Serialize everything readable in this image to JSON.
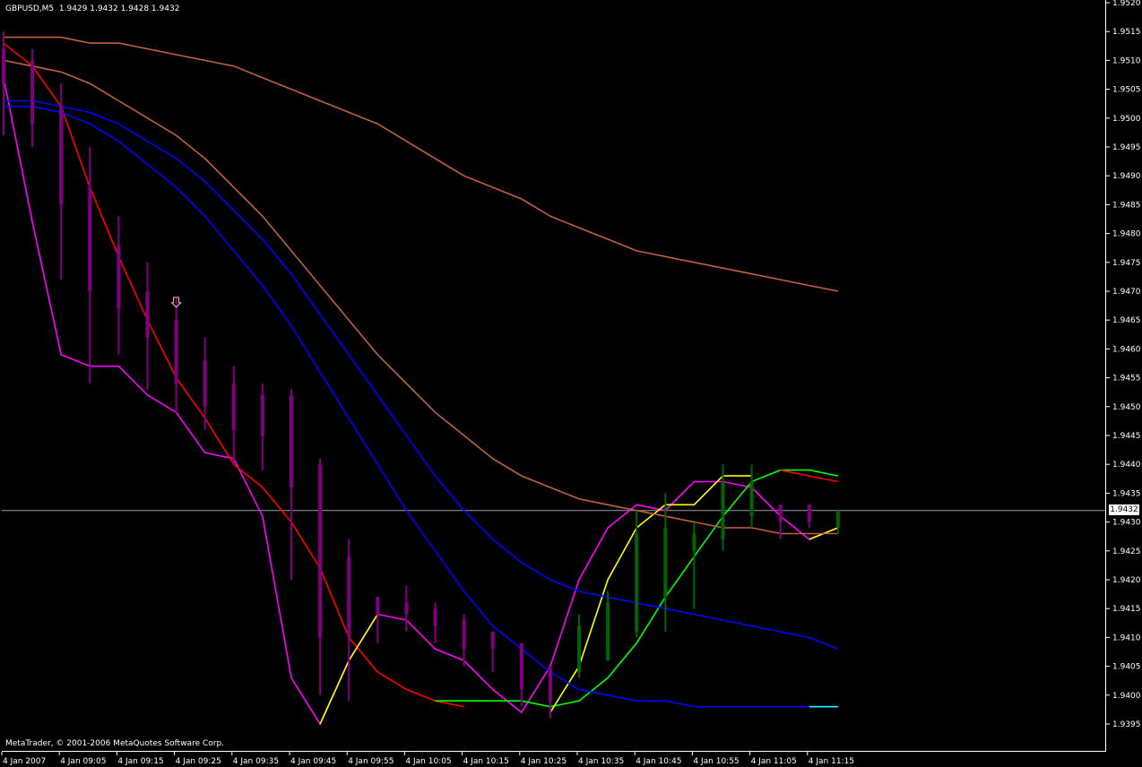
{
  "window": {
    "title": "GBPUSD,M5  1.9429 1.9432 1.9428 1.9432",
    "copyright": "MetaTrader, © 2001-2006 MetaQuotes Software Corp.",
    "current_price_label": "1.9432"
  },
  "colors": {
    "background": "#000000",
    "bull_candle": "#006400",
    "bear_candle": "#800080",
    "ma_fast_magenta": "#ff00ff",
    "ma_red": "#ff0000",
    "ma_yellow": "#ffff00",
    "ma_green": "#00ff00",
    "ma_blue": "#0000ff",
    "ma_brown": "#c06040",
    "ma_cyan": "#00ffff",
    "arrow": "#ffb6c1",
    "axis_text": "#ffffff"
  },
  "chart_data": {
    "type": "line",
    "symbol": "GBPUSD",
    "timeframe": "M5",
    "ylim": [
      1.9392,
      1.952
    ],
    "y_ticks": [
      "1.9395",
      "1.9400",
      "1.9405",
      "1.9410",
      "1.9415",
      "1.9420",
      "1.9425",
      "1.9430",
      "1.9435",
      "1.9440",
      "1.9445",
      "1.9450",
      "1.9455",
      "1.9460",
      "1.9465",
      "1.9470",
      "1.9475",
      "1.9480",
      "1.9485",
      "1.9490",
      "1.9495",
      "1.9500",
      "1.9505",
      "1.9510",
      "1.9515",
      "1.9520"
    ],
    "x_ticks": [
      "4 Jan 2007",
      "4 Jan 09:05",
      "4 Jan 09:15",
      "4 Jan 09:25",
      "4 Jan 09:35",
      "4 Jan 09:45",
      "4 Jan 09:55",
      "4 Jan 10:05",
      "4 Jan 10:15",
      "4 Jan 10:25",
      "4 Jan 10:35",
      "4 Jan 10:45",
      "4 Jan 10:55",
      "4 Jan 11:05",
      "4 Jan 11:15"
    ],
    "candles": [
      {
        "o": 1.9512,
        "h": 1.9515,
        "l": 1.9497,
        "c": 1.9506
      },
      {
        "o": 1.951,
        "h": 1.9512,
        "l": 1.9495,
        "c": 1.9499
      },
      {
        "o": 1.9502,
        "h": 1.9506,
        "l": 1.9472,
        "c": 1.9485
      },
      {
        "o": 1.9488,
        "h": 1.9495,
        "l": 1.9454,
        "c": 1.947
      },
      {
        "o": 1.9478,
        "h": 1.9483,
        "l": 1.9459,
        "c": 1.9467
      },
      {
        "o": 1.947,
        "h": 1.9475,
        "l": 1.9453,
        "c": 1.9462
      },
      {
        "o": 1.9465,
        "h": 1.9469,
        "l": 1.9449,
        "c": 1.9454
      },
      {
        "o": 1.9458,
        "h": 1.9462,
        "l": 1.9446,
        "c": 1.945
      },
      {
        "o": 1.9454,
        "h": 1.9457,
        "l": 1.944,
        "c": 1.9446
      },
      {
        "o": 1.9452,
        "h": 1.9454,
        "l": 1.9439,
        "c": 1.9445
      },
      {
        "o": 1.9452,
        "h": 1.9453,
        "l": 1.942,
        "c": 1.9436
      },
      {
        "o": 1.944,
        "h": 1.9441,
        "l": 1.94,
        "c": 1.941
      },
      {
        "o": 1.9424,
        "h": 1.9427,
        "l": 1.9399,
        "c": 1.941
      },
      {
        "o": 1.9417,
        "h": 1.9417,
        "l": 1.9409,
        "c": 1.9414
      },
      {
        "o": 1.9416,
        "h": 1.9419,
        "l": 1.9411,
        "c": 1.9414
      },
      {
        "o": 1.9415,
        "h": 1.9416,
        "l": 1.9409,
        "c": 1.9412
      },
      {
        "o": 1.9413,
        "h": 1.9414,
        "l": 1.9405,
        "c": 1.9408
      },
      {
        "o": 1.9411,
        "h": 1.9411,
        "l": 1.9404,
        "c": 1.9408
      },
      {
        "o": 1.9409,
        "h": 1.9409,
        "l": 1.9398,
        "c": 1.9401
      },
      {
        "o": 1.9405,
        "h": 1.9405,
        "l": 1.9396,
        "c": 1.9399
      },
      {
        "o": 1.9404,
        "h": 1.9414,
        "l": 1.9403,
        "c": 1.9412
      },
      {
        "o": 1.9406,
        "h": 1.9418,
        "l": 1.9406,
        "c": 1.9416
      },
      {
        "o": 1.9411,
        "h": 1.9432,
        "l": 1.941,
        "c": 1.9428
      },
      {
        "o": 1.9417,
        "h": 1.9435,
        "l": 1.9411,
        "c": 1.9429
      },
      {
        "o": 1.9425,
        "h": 1.943,
        "l": 1.9415,
        "c": 1.9428
      },
      {
        "o": 1.9427,
        "h": 1.944,
        "l": 1.9425,
        "c": 1.9437
      },
      {
        "o": 1.9431,
        "h": 1.944,
        "l": 1.9429,
        "c": 1.9437
      },
      {
        "o": 1.9433,
        "h": 1.9433,
        "l": 1.9427,
        "c": 1.943
      },
      {
        "o": 1.9433,
        "h": 1.9433,
        "l": 1.9429,
        "c": 1.943
      },
      {
        "o": 1.9429,
        "h": 1.9432,
        "l": 1.9428,
        "c": 1.9432
      }
    ],
    "arrow_marker": {
      "bar": 6,
      "price": 1.9468,
      "direction": "down"
    },
    "current_price": 1.9432,
    "series": [
      {
        "color": "#ff00ff",
        "values": [
          1.9507,
          1.9482,
          1.9459,
          1.9457,
          1.9457,
          1.9452,
          1.9449,
          1.9442,
          1.9441,
          1.9431,
          1.9403,
          1.9395,
          1.9406,
          1.9414,
          1.9413,
          1.9408,
          1.9406,
          1.9401,
          1.9397,
          1.9405,
          1.942,
          1.9429,
          1.9433,
          1.9432,
          1.9437,
          1.9437,
          1.9436,
          1.9431,
          1.9427,
          1.9429
        ]
      },
      {
        "color": "#ff0000",
        "values": [
          1.9513,
          1.9509,
          1.9502,
          1.9488,
          1.9476,
          1.9465,
          1.9455,
          1.9448,
          1.944,
          1.9436,
          1.943,
          1.9422,
          1.941,
          1.9404,
          1.9401,
          1.9399,
          1.9398
        ]
      },
      {
        "color": "#00ff00",
        "values": [
          null,
          null,
          null,
          null,
          null,
          null,
          null,
          null,
          null,
          null,
          null,
          null,
          null,
          null,
          null,
          1.9399,
          1.9399,
          1.9399,
          1.9399,
          1.9398,
          1.9399,
          1.9403,
          1.9409,
          1.9417,
          1.9424,
          1.9431,
          1.9437,
          1.9439,
          1.9439,
          1.9438
        ]
      },
      {
        "color": "#ff0000",
        "values": [
          null,
          null,
          null,
          null,
          null,
          null,
          null,
          null,
          null,
          null,
          null,
          null,
          null,
          null,
          null,
          null,
          null,
          null,
          null,
          null,
          null,
          null,
          null,
          null,
          null,
          null,
          null,
          1.9439,
          1.9438,
          1.9437
        ]
      },
      {
        "color": "#ffff00",
        "values": [
          null,
          null,
          null,
          null,
          null,
          null,
          null,
          null,
          null,
          null,
          null,
          1.9395,
          1.9406,
          1.9414,
          null,
          null,
          null,
          null,
          null,
          1.9397,
          1.9405,
          1.942,
          1.9429,
          1.9433,
          1.9433,
          1.9438,
          1.9438,
          null,
          1.9427,
          1.9429
        ]
      },
      {
        "color": "#0000ff",
        "values": [
          1.9502,
          1.9502,
          1.9501,
          1.9499,
          1.9496,
          1.9492,
          1.9488,
          1.9483,
          1.9477,
          1.9471,
          1.9464,
          1.9456,
          1.9448,
          1.944,
          1.9432,
          1.9425,
          1.9418,
          1.9412,
          1.9408,
          1.9404,
          1.9401,
          1.94,
          1.9399,
          1.9399,
          1.9398,
          1.9398,
          1.9398,
          1.9398,
          1.9398,
          1.9398
        ]
      },
      {
        "color": "#0000ff",
        "values": [
          1.9503,
          1.9503,
          1.9502,
          1.9501,
          1.9499,
          1.9496,
          1.9493,
          1.9489,
          1.9484,
          1.9479,
          1.9473,
          1.9466,
          1.9459,
          1.9452,
          1.9445,
          1.9438,
          1.9432,
          1.9427,
          1.9423,
          1.942,
          1.9418,
          1.9417,
          1.9416,
          1.9415,
          1.9414,
          1.9413,
          1.9412,
          1.9411,
          1.941,
          1.9408
        ]
      },
      {
        "color": "#c06040",
        "values": [
          1.9514,
          1.9514,
          1.9514,
          1.9513,
          1.9513,
          1.9512,
          1.9511,
          1.951,
          1.9509,
          1.9507,
          1.9505,
          1.9503,
          1.9501,
          1.9499,
          1.9496,
          1.9493,
          1.949,
          1.9488,
          1.9486,
          1.9483,
          1.9481,
          1.9479,
          1.9477,
          1.9476,
          1.9475,
          1.9474,
          1.9473,
          1.9472,
          1.9471,
          1.947
        ]
      },
      {
        "color": "#c06040",
        "values": [
          1.951,
          1.9509,
          1.9508,
          1.9506,
          1.9503,
          1.95,
          1.9497,
          1.9493,
          1.9488,
          1.9483,
          1.9477,
          1.9471,
          1.9465,
          1.9459,
          1.9454,
          1.9449,
          1.9445,
          1.9441,
          1.9438,
          1.9436,
          1.9434,
          1.9433,
          1.9432,
          1.9431,
          1.943,
          1.9429,
          1.9429,
          1.9428,
          1.9428,
          1.9428
        ]
      },
      {
        "color": "#00ffff",
        "values": [
          null,
          null,
          null,
          null,
          null,
          null,
          null,
          null,
          null,
          null,
          null,
          null,
          null,
          null,
          null,
          null,
          null,
          null,
          null,
          null,
          null,
          null,
          null,
          null,
          null,
          null,
          null,
          null,
          1.9398,
          1.9398
        ]
      }
    ]
  }
}
